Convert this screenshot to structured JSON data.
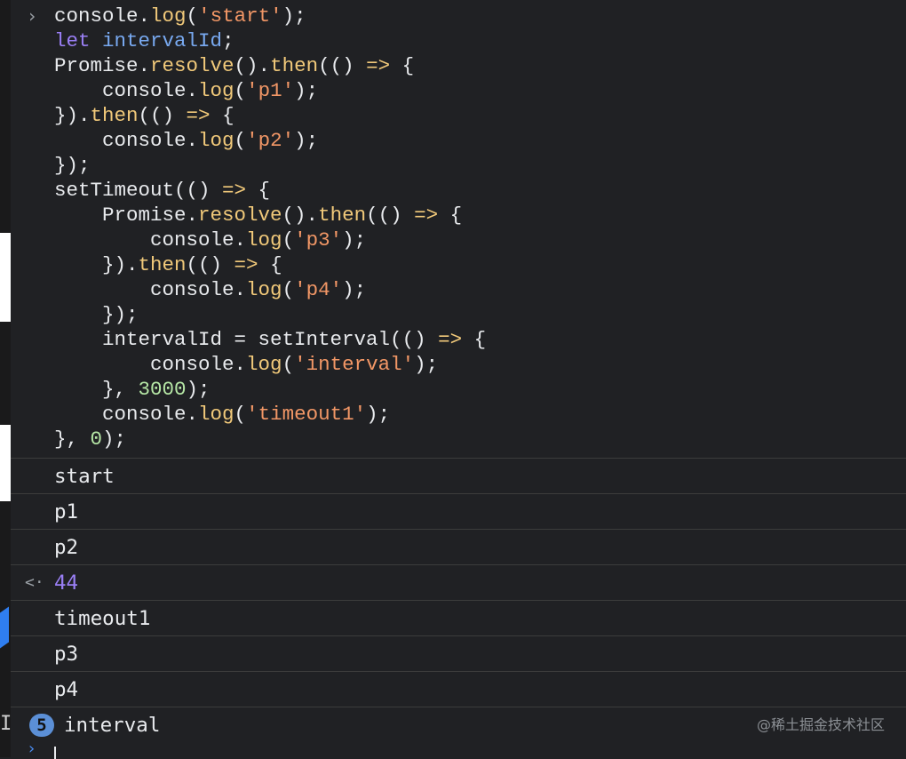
{
  "console": {
    "input_prompt": "›",
    "code_lines": [
      "console.log('start');",
      "let intervalId;",
      "Promise.resolve().then(() => {",
      "    console.log('p1');",
      "}).then(() => {",
      "    console.log('p2');",
      "});",
      "setTimeout(() => {",
      "    Promise.resolve().then(() => {",
      "        console.log('p3');",
      "    }).then(() => {",
      "        console.log('p4');",
      "    });",
      "    intervalId = setInterval(() => {",
      "        console.log('interval');",
      "    }, 3000);",
      "    console.log('timeout1');",
      "}, 0);"
    ],
    "outputs": [
      {
        "text": "start",
        "type": "log"
      },
      {
        "text": "p1",
        "type": "log"
      },
      {
        "text": "p2",
        "type": "log"
      },
      {
        "text": "44",
        "type": "return",
        "icon": "return-arrow-icon"
      },
      {
        "text": "timeout1",
        "type": "log"
      },
      {
        "text": "p3",
        "type": "log"
      },
      {
        "text": "p4",
        "type": "log"
      },
      {
        "text": "interval",
        "type": "log",
        "repeat_count": "5"
      }
    ],
    "watermark": "@稀土掘金技术社区",
    "colors": {
      "background": "#202124",
      "keyword": "#9a7ff5",
      "variable": "#78a9f0",
      "method": "#f1c97a",
      "string": "#f29766",
      "number": "#b5e6a5",
      "text": "#e8eaed",
      "badge": "#5b8fd6"
    }
  }
}
